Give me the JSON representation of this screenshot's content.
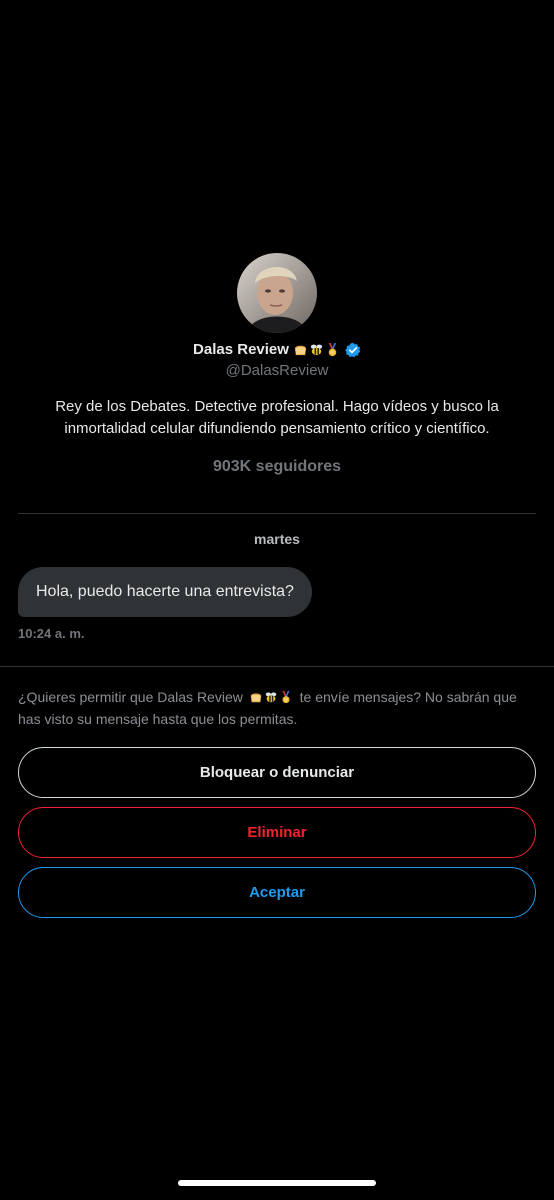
{
  "profile": {
    "name": "Dalas Review",
    "emoji_badges": [
      "bread-emoji",
      "bee-emoji",
      "medal-emoji"
    ],
    "verified_icon": "verified-badge-icon",
    "handle": "@DalasReview",
    "bio": "Rey de los Debates. Detective profesional. Hago vídeos y busco la inmortalidad celular difundiendo pensamiento crítico y científico.",
    "followers": "903K seguidores"
  },
  "conversation": {
    "day_label": "martes",
    "messages": [
      {
        "text": "Hola, puedo hacerte una entrevista?",
        "time": "10:24 a. m."
      }
    ]
  },
  "request": {
    "text_before": "¿Quieres permitir que Dalas Review",
    "text_after": "te envíe mensajes? No sabrán que has visto su mensaje hasta que los permitas."
  },
  "actions": {
    "block_label": "Bloquear o denunciar",
    "delete_label": "Eliminar",
    "accept_label": "Aceptar"
  },
  "colors": {
    "background": "#000000",
    "accent_blue": "#1d9bf0",
    "danger_red": "#f4212e",
    "bubble_gray": "#2f3336",
    "muted_text": "#71767b"
  }
}
